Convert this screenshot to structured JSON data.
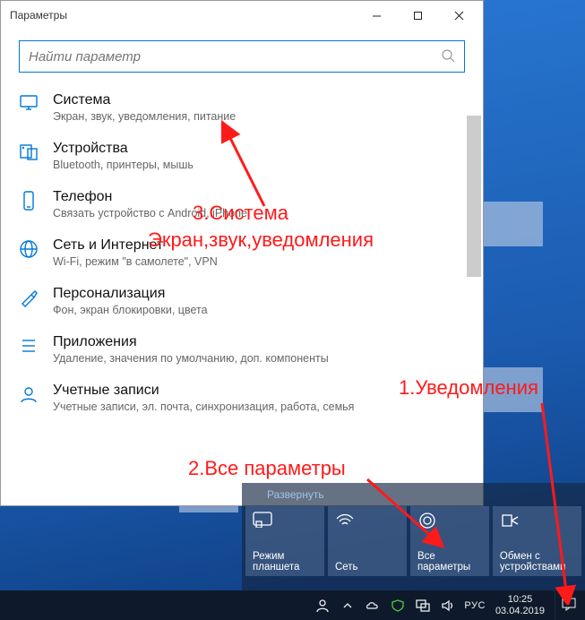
{
  "window": {
    "title": "Параметры",
    "search_placeholder": "Найти параметр"
  },
  "items": [
    {
      "label": "Система",
      "desc": "Экран, звук, уведомления, питание"
    },
    {
      "label": "Устройства",
      "desc": "Bluetooth, принтеры, мышь"
    },
    {
      "label": "Телефон",
      "desc": "Связать устройство с Android, iPhone"
    },
    {
      "label": "Сеть и Интернет",
      "desc": "Wi-Fi, режим \"в самолете\", VPN"
    },
    {
      "label": "Персонализация",
      "desc": "Фон, экран блокировки, цвета"
    },
    {
      "label": "Приложения",
      "desc": "Удаление, значения по умолчанию, доп. компоненты"
    },
    {
      "label": "Учетные записи",
      "desc": "Учетные записи, эл. почта, синхронизация, работа, семья"
    }
  ],
  "action_center": {
    "expand": "Развернуть",
    "tiles": [
      "Режим планшета",
      "Сеть",
      "Все параметры",
      "Обмен с устройствами"
    ]
  },
  "taskbar": {
    "lang": "РУС",
    "time": "10:25",
    "date": "03.04.2019"
  },
  "annotations": {
    "a1": "1.Уведомления",
    "a2": "2.Все параметры",
    "a3a": "3.Система",
    "a3b": "Экран,звук,уведомления"
  }
}
